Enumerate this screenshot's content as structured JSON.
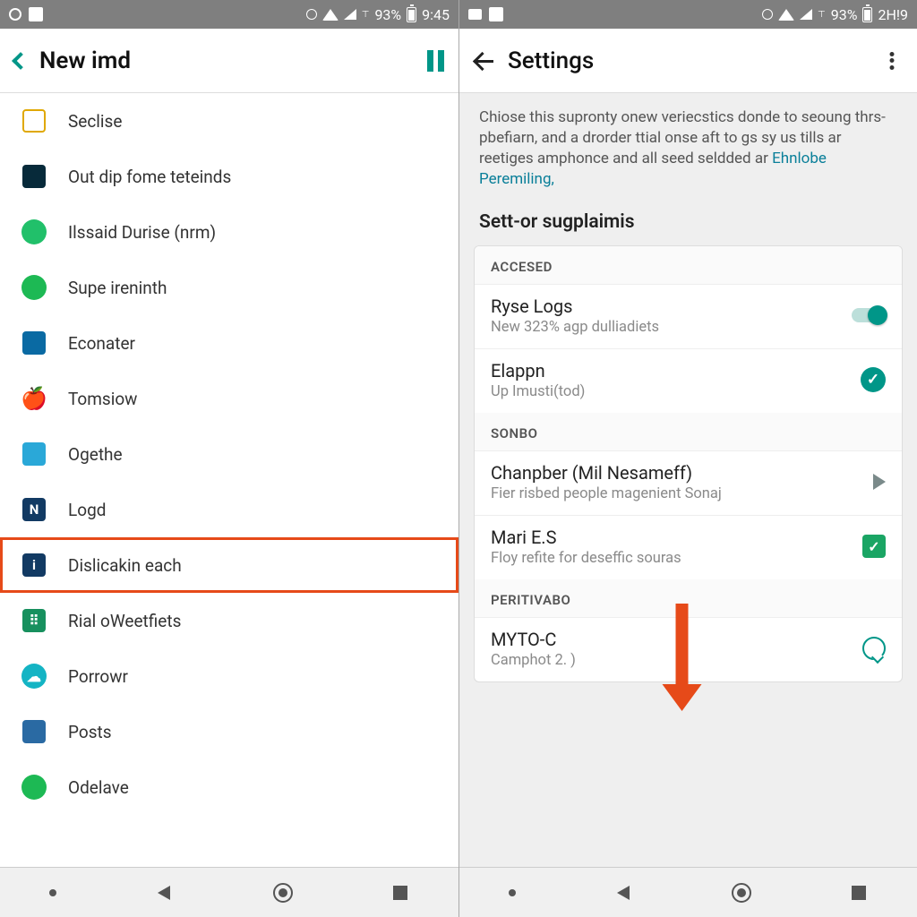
{
  "left": {
    "status": {
      "battery_pct": "93%",
      "time": "9:45"
    },
    "header": {
      "title": "New imd"
    },
    "items": [
      {
        "label": "Seclise",
        "icon_name": "doc-icon",
        "bg": "#ffffff",
        "fg": "#e0a800",
        "shape": "sq",
        "border": "#e0a800",
        "hl": false
      },
      {
        "label": "Out dip fome teteinds",
        "icon_name": "chat-dark-icon",
        "bg": "#072a3a",
        "fg": "#7fe0c0",
        "shape": "sq",
        "hl": false
      },
      {
        "label": "Ilssaid Durise (nrm)",
        "icon_name": "download-icon",
        "bg": "#21c06a",
        "fg": "#ffffff",
        "shape": "circ",
        "hl": false
      },
      {
        "label": "Supe ireninth",
        "icon_name": "spotify-icon",
        "bg": "#1db954",
        "fg": "#ffffff",
        "shape": "circ",
        "hl": false
      },
      {
        "label": "Econater",
        "icon_name": "picture-icon",
        "bg": "#0a6aa3",
        "fg": "#ffffff",
        "shape": "sq",
        "hl": false
      },
      {
        "label": "Tomsiow",
        "icon_name": "apple-icon",
        "bg": "transparent",
        "fg": "#1a9fb5",
        "shape": "glyph",
        "glyph": "🍎",
        "hl": false
      },
      {
        "label": "Ogethe",
        "icon_name": "calendar-icon",
        "bg": "#2aa8d8",
        "fg": "#ffffff",
        "shape": "sq",
        "hl": false
      },
      {
        "label": "Logd",
        "icon_name": "badge-n-icon",
        "bg": "#123a63",
        "fg": "#ffffff",
        "shape": "sq",
        "glyph": "N",
        "hl": false
      },
      {
        "label": "Dislicakin each",
        "icon_name": "info-icon",
        "bg": "#123a63",
        "fg": "#ffffff",
        "shape": "sq",
        "glyph": "i",
        "hl": true
      },
      {
        "label": "Rial oWeetfiets",
        "icon_name": "grid-icon",
        "bg": "#17905e",
        "fg": "#ffffff",
        "shape": "sq",
        "glyph": "⠿",
        "hl": false
      },
      {
        "label": "Porrowr",
        "icon_name": "cloud-icon",
        "bg": "#14b4c4",
        "fg": "#ffffff",
        "shape": "circ",
        "glyph": "☁",
        "hl": false
      },
      {
        "label": "Posts",
        "icon_name": "flag-icon",
        "bg": "#2a6aa3",
        "fg": "#ffffff",
        "shape": "sq",
        "hl": false
      },
      {
        "label": "Odelave",
        "icon_name": "spotify-icon",
        "bg": "#1db954",
        "fg": "#ffffff",
        "shape": "circ",
        "hl": false
      }
    ]
  },
  "right": {
    "status": {
      "battery_pct": "93%",
      "time": "2H!9"
    },
    "header": {
      "title": "Settings"
    },
    "intro_text": "Chiose this supronty onew veriecstics donde to seoung thrs-pbefiarn, and a drorder ttial onse aft to gs sy us tills ar reetiges amphonce and all seed seldded ar ",
    "intro_link": "Ehnlobe Peremiling,",
    "section_title": "Sett-or sugplaimis",
    "sections": [
      {
        "header": "ACCESED",
        "rows": [
          {
            "primary": "Ryse Logs",
            "secondary": "New 323% agp dulliadiets",
            "trail": "switch"
          },
          {
            "primary": "Elappn",
            "secondary": "Up Imusti(tod)",
            "trail": "check-circle"
          }
        ]
      },
      {
        "header": "SONBO",
        "rows": [
          {
            "primary": "Chanpber (Mil Nesameff)",
            "secondary": "Fier risbed people magenient Sonaj",
            "trail": "play"
          },
          {
            "primary": "Mari E.S",
            "secondary": "Floy refite for deseffic souras",
            "trail": "check-box"
          }
        ]
      },
      {
        "header": "PERITIVABO",
        "rows": [
          {
            "primary": "MYTO-C",
            "secondary": "Camphot 2.   )",
            "trail": "chat"
          }
        ]
      }
    ]
  }
}
